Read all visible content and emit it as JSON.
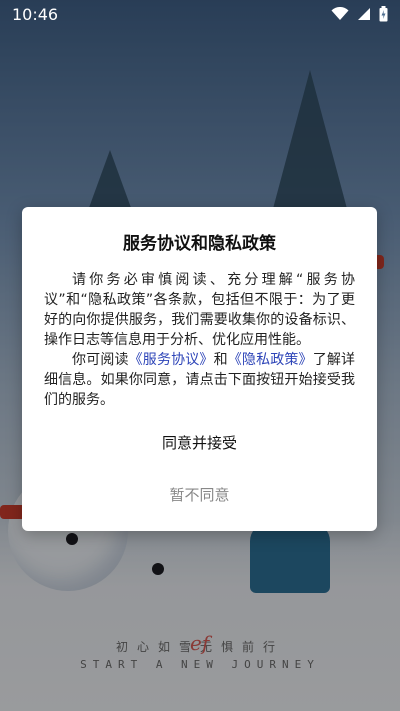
{
  "status_bar": {
    "time": "10:46"
  },
  "dialog": {
    "title": "服务协议和隐私政策",
    "paragraph1": "请你务必审慎阅读、充分理解“服务协议”和“隐私政策”各条款，包括但不限于：为了更好的向你提供服务，我们需要收集你的设备标识、操作日志等信息用于分析、优化应用性能。",
    "p2_prefix": "你可阅读",
    "service_link": "《服务协议》",
    "p2_and": "和",
    "privacy_link": "《隐私政策》",
    "p2_suffix": "了解详细信息。如果你同意，请点击下面按钮开始接受我们的服务。",
    "agree_label": "同意并接受",
    "disagree_label": "暂不同意"
  },
  "background": {
    "footer_cn": "初心如雪无惧前行",
    "footer_en": "START A NEW JOURNEY",
    "signature": "ef"
  },
  "colors": {
    "link": "#2e45b8",
    "disagree_text": "#888888",
    "dialog_bg": "#ffffff"
  },
  "icons": [
    "wifi-icon",
    "signal-icon",
    "battery-icon"
  ]
}
